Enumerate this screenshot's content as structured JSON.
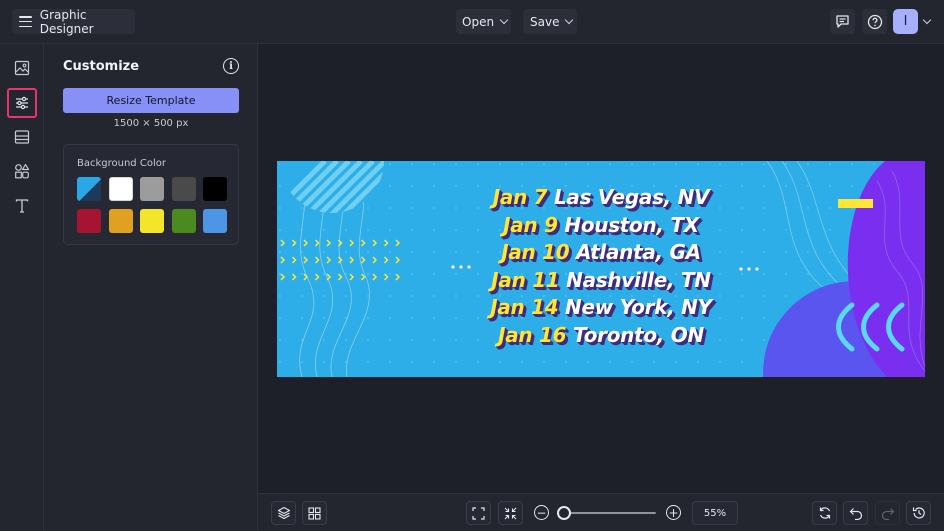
{
  "header": {
    "app_name": "Graphic Designer",
    "open_label": "Open",
    "save_label": "Save",
    "avatar_initial": "I"
  },
  "panel": {
    "title": "Customize",
    "resize_label": "Resize Template",
    "dimensions": "1500 × 500 px",
    "bg_label": "Background Color",
    "swatches": [
      "#2aa8e6",
      "#ffffff",
      "#9c9c9c",
      "#4a4a4a",
      "#000000",
      "#a61431",
      "#e0a020",
      "#f5e52a",
      "#4c8a20",
      "#4d96e6"
    ]
  },
  "design": {
    "events": [
      {
        "date": "Jan 7",
        "city": "Las Vegas, NV"
      },
      {
        "date": "Jan 9",
        "city": "Houston, TX"
      },
      {
        "date": "Jan 10",
        "city": "Atlanta, GA"
      },
      {
        "date": "Jan 11",
        "city": "Nashville, TN"
      },
      {
        "date": "Jan 14",
        "city": "New York, NY"
      },
      {
        "date": "Jan 16",
        "city": "Toronto, ON"
      }
    ]
  },
  "toolbar": {
    "zoom_percent": "55%",
    "zoom_level": 0.06
  },
  "colors": {
    "accent": "#8690f7",
    "active_rail": "#e8336b",
    "banner_blue": "#2daee8",
    "banner_purple": "#7a2ff0",
    "banner_yellow": "#ffe535"
  }
}
